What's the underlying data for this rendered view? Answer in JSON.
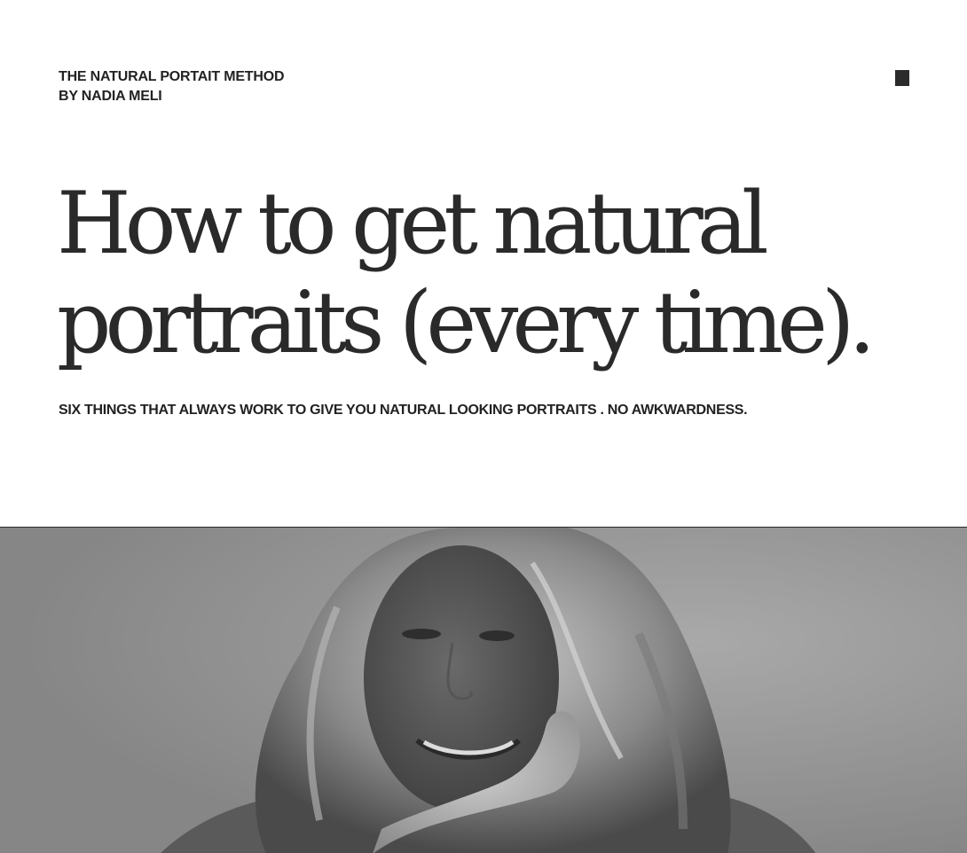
{
  "brand": {
    "line1": "THE NATURAL PORTAIT METHOD",
    "line2": "BY NADIA MELI"
  },
  "icons": {
    "corner": "square-icon"
  },
  "headline": {
    "line1": "How to get natural",
    "line2": "portraits (every time)."
  },
  "subheadline": "SIX THINGS THAT ALWAYS WORK TO GIVE YOU NATURAL LOOKING PORTRAITS . NO AWKWARDNESS.",
  "colors": {
    "text": "#2a2a2a",
    "background": "#ffffff",
    "photo_tone": "#9a9a9a"
  }
}
